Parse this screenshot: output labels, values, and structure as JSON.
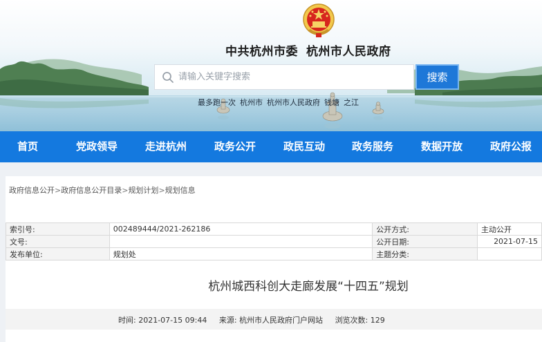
{
  "header": {
    "title_party": "中共杭州市委",
    "title_gov": "杭州市人民政府"
  },
  "search": {
    "placeholder": "请输入关键字搜索",
    "button_label": "搜索",
    "hot_words": [
      "最多跑一次",
      "杭州市",
      "杭州市人民政府",
      "钱塘",
      "之江"
    ]
  },
  "nav": {
    "items": [
      "首页",
      "党政领导",
      "走进杭州",
      "政务公开",
      "政民互动",
      "政务服务",
      "数据开放",
      "政府公报"
    ]
  },
  "breadcrumb": {
    "items": [
      "政府信息公开",
      "政府信息公开目录",
      "规划计划",
      "规划信息"
    ],
    "separator": ">"
  },
  "meta": {
    "index_label": "索引号:",
    "index_value": "002489444/2021-262186",
    "open_mode_label": "公开方式:",
    "open_mode_value": "主动公开",
    "doc_no_label": "文号:",
    "doc_no_value": "",
    "open_date_label": "公开日期:",
    "open_date_value": "2021-07-15",
    "publisher_label": "发布单位:",
    "publisher_value": "规划处",
    "category_label": "主题分类:",
    "category_value": ""
  },
  "article": {
    "title": "杭州城西科创大走廊发展“十四五”规划",
    "time_label": "时间:",
    "time_value": "2021-07-15 09:44",
    "source_label": "来源:",
    "source_value": "杭州市人民政府门户网站",
    "views_label": "浏览次数:",
    "views_value": "129"
  },
  "colors": {
    "nav_bg": "#1479df",
    "search_button": "#1e78d8",
    "content_bg": "#eef1f5"
  }
}
